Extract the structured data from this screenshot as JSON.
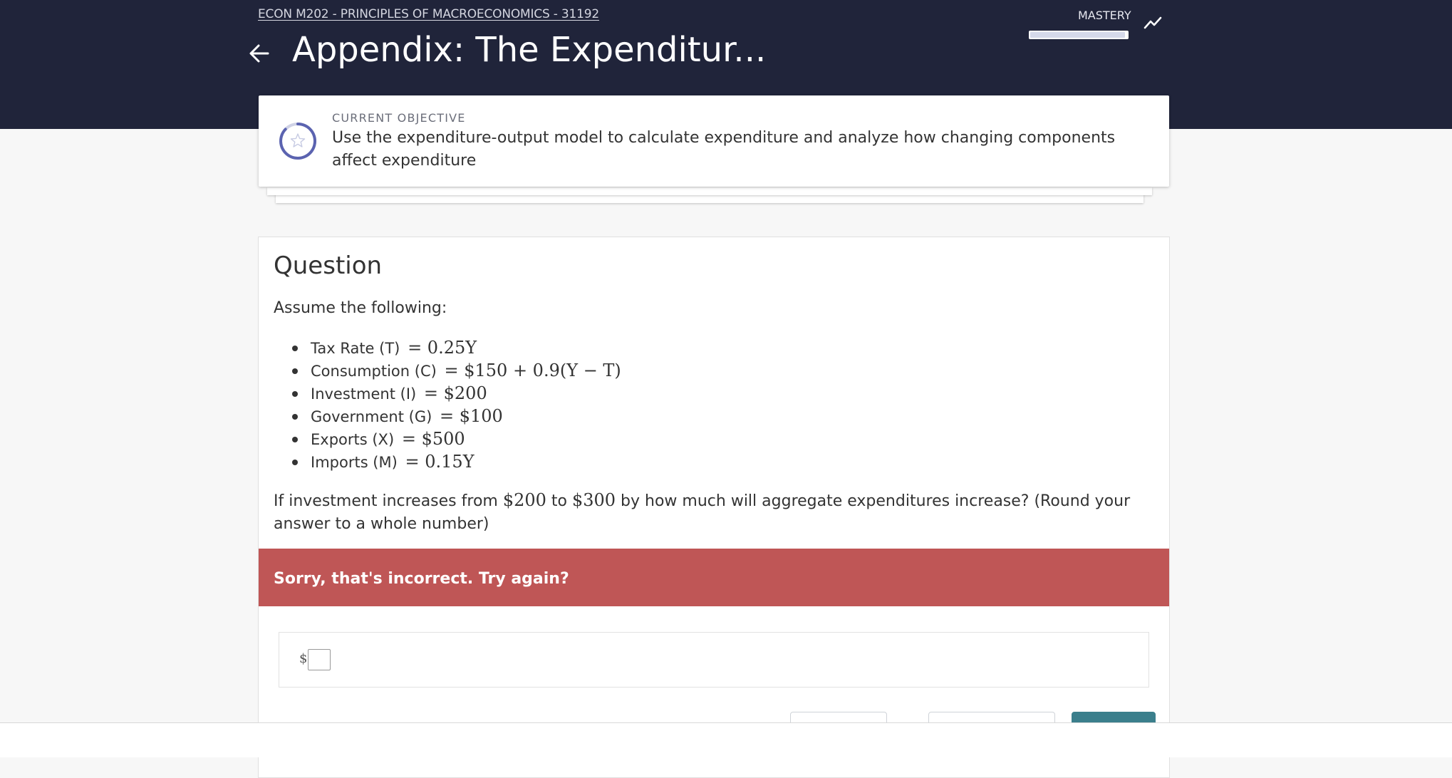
{
  "header": {
    "course_link": "ECON M202 - PRINCIPLES OF MACROECONOMICS - 31192",
    "title": "Appendix: The Expenditur...",
    "mastery_label": "MASTERY",
    "mastery_progress": 0.98,
    "back_icon": "arrow-left-icon",
    "trend_icon": "trending-line-icon"
  },
  "objective": {
    "label": "CURRENT OBJECTIVE",
    "text": "Use the expenditure-output model to calculate expenditure and analyze how changing components affect expenditure",
    "icon": "star-progress-ring-icon"
  },
  "question": {
    "heading": "Question",
    "intro": "Assume the following:",
    "items": [
      {
        "label": "Tax Rate (T)",
        "expr": "= 0.25Y"
      },
      {
        "label": "Consumption (C)",
        "expr": "= $150 + 0.9(Y − T)"
      },
      {
        "label": "Investment (I)",
        "expr": "= $200"
      },
      {
        "label": "Government (G)",
        "expr": "= $100"
      },
      {
        "label": "Exports (X)",
        "expr": "= $500"
      },
      {
        "label": "Imports (M)",
        "expr": "= 0.15Y"
      }
    ],
    "prompt": {
      "part1": "If investment increases from ",
      "from": "$200",
      "part2": " to ",
      "to": "$300",
      "part3": " by how much will aggregate expenditures increase? (Round your answer to a whole number)"
    },
    "feedback": "Sorry, that's incorrect. Try again?",
    "answer": {
      "currency": "$",
      "value": ""
    }
  },
  "colors": {
    "header_bg": "#20243a",
    "feedback_bg": "#bf5656",
    "primary_button": "#3b7f8c",
    "ring_accent": "#5b63b0"
  }
}
